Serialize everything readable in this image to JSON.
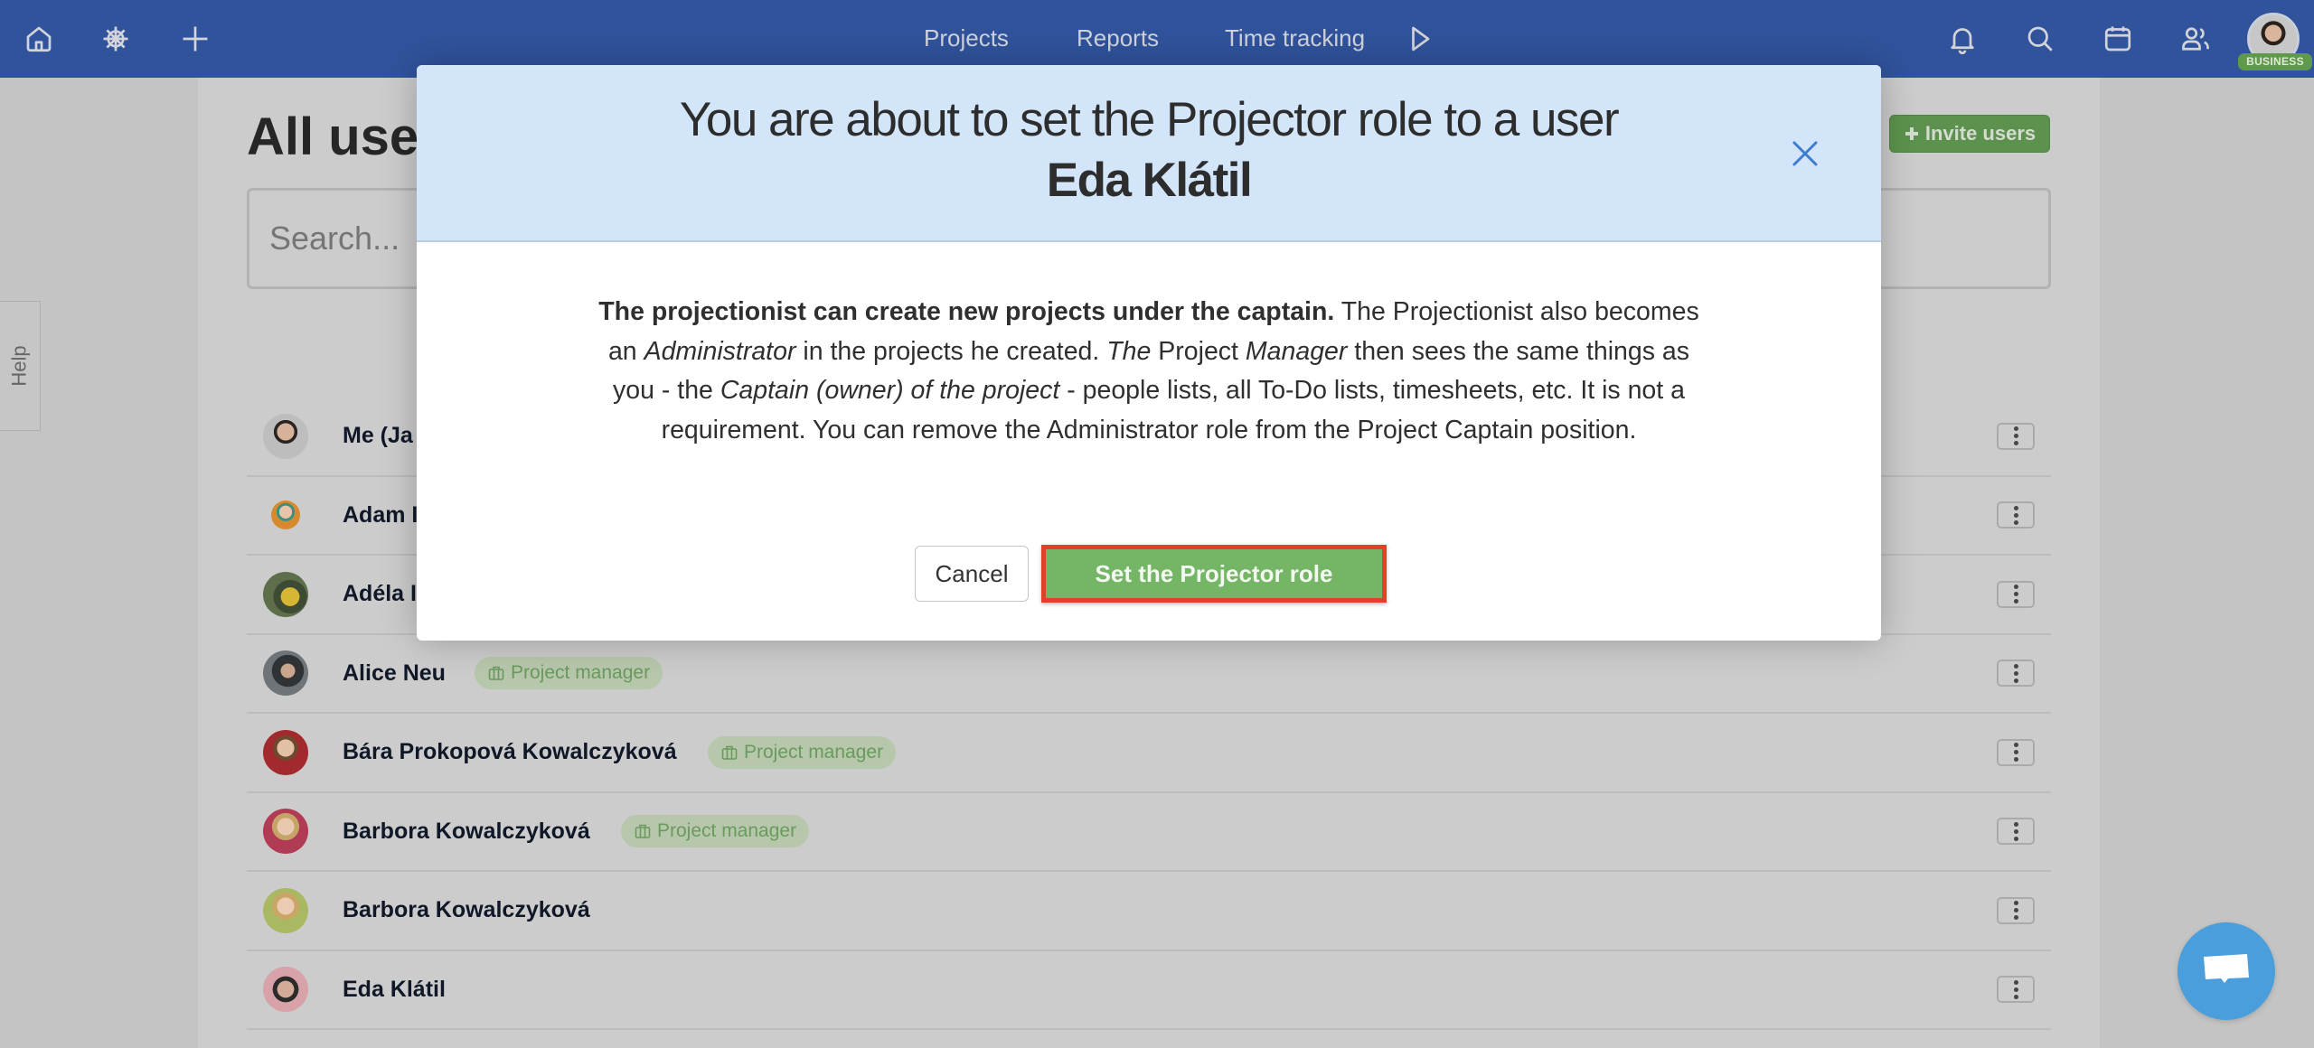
{
  "topnav": {
    "left_icons": [
      "home-icon",
      "ship-wheel-icon",
      "plus-icon"
    ],
    "links": [
      "Projects",
      "Reports",
      "Time tracking"
    ],
    "play_icon": "play-icon",
    "right_icons": [
      "bell-icon",
      "search-icon",
      "calendar-icon",
      "users-icon"
    ],
    "plan_badge": "BUSINESS"
  },
  "page": {
    "title": "All users",
    "invite_button": "Invite users",
    "search_placeholder": "Search...",
    "help_tab": "Help",
    "users": [
      {
        "name": "Me (Ja",
        "role": ""
      },
      {
        "name": "Adam I",
        "role": ""
      },
      {
        "name": "Adéla I",
        "role": ""
      },
      {
        "name": "Alice Neu",
        "role": "Project manager"
      },
      {
        "name": "Bára Prokopová Kowalczyková",
        "role": "Project manager"
      },
      {
        "name": "Barbora Kowalczyková",
        "role": "Project manager"
      },
      {
        "name": "Barbora Kowalczyková",
        "role": ""
      },
      {
        "name": "Eda Klátil",
        "role": ""
      }
    ]
  },
  "modal": {
    "title": "You are about to set the Projector role to a user",
    "user_name": "Eda Klátil",
    "body": {
      "bold_lead": "The projectionist can create new projects under the captain.",
      "text1": " The Projectionist also becomes an ",
      "italic1": "Administrator",
      "text2": " in the projects he created. ",
      "italic2": "The",
      "text3": " Project ",
      "italic3": "Manager",
      "text4": " then sees the same things as you - the ",
      "italic4": "Captain (owner) of the project",
      "text5": " - people lists, all To-Do lists, timesheets, etc. It is not a requirement. You can remove the Administrator role from the Project Captain position."
    },
    "cancel_label": "Cancel",
    "confirm_label": "Set the Projector role"
  },
  "colors": {
    "nav_bg": "#30539c",
    "modal_header_bg": "#d3e5f8",
    "confirm_bg": "#74b566",
    "highlight_border": "#e04228",
    "chat_bubble": "#4a9edb",
    "role_badge_text": "#6a9a5e"
  }
}
